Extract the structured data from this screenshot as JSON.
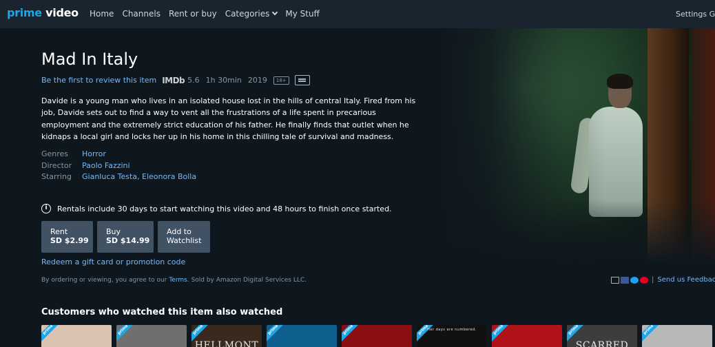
{
  "nav": {
    "logo_part1": "prime",
    "logo_part2": "video",
    "items": [
      "Home",
      "Channels",
      "Rent or buy",
      "Categories",
      "My Stuff"
    ],
    "settings": "Settings",
    "settings_partial": "G"
  },
  "title": "Mad In Italy",
  "meta": {
    "review_link": "Be the first to review this item",
    "imdb_label": "IMDb",
    "imdb_rating": "5.6",
    "runtime": "1h 30min",
    "year": "2019",
    "rating_badge": "18+",
    "cc_icon": "subtitles-icon"
  },
  "synopsis": "Davide is a young man who lives in an isolated house lost in the hills of central Italy. Fired from his job, Davide sets out to find a way to vent all the frustrations of a life spent in precarious employment and the extremely strict education of his father. He finally finds that outlet when he kidnaps a local girl and locks her up in his home in this chilling tale of survival and madness.",
  "details": {
    "genres_label": "Genres",
    "genres": "Horror",
    "director_label": "Director",
    "director": "Paolo Fazzini",
    "starring_label": "Starring",
    "starring": "Gianluca Testa, Eleonora Bolla"
  },
  "rental_info": "Rentals include 30 days to start watching this video and 48 hours to finish once started.",
  "buttons": {
    "rent_line1": "Rent",
    "rent_line2": "SD $2.99",
    "buy_line1": "Buy",
    "buy_line2": "SD $14.99",
    "watch_line1": "Add to",
    "watch_line2": "Watchlist"
  },
  "redeem": "Redeem a gift card or promotion code",
  "legal": {
    "before": "By ordering or viewing, you agree to our ",
    "terms": "Terms",
    "after": ". Sold by Amazon Digital Services LLC."
  },
  "social": {
    "separator": "|",
    "feedback": "Send us Feedback"
  },
  "row": {
    "title": "Customers who watched this item also watched",
    "ribbon": "prime",
    "thumbs": [
      {
        "bg": "#d9c3b0",
        "text": ""
      },
      {
        "bg": "#6f6f6f",
        "text": ""
      },
      {
        "bg": "#3a2a1e",
        "text": "HELLMONT"
      },
      {
        "bg": "#0f5f8f",
        "text": ""
      },
      {
        "bg": "#8a0f12",
        "text": ""
      },
      {
        "bg": "#111111",
        "text": "Her days are numbered."
      },
      {
        "bg": "#b0121a",
        "text": ""
      },
      {
        "bg": "#3d3d3d",
        "text": "SCARRED"
      },
      {
        "bg": "#b8b8b8",
        "text": ""
      }
    ]
  },
  "colors": {
    "background": "#0f171e",
    "topbar": "#1a242f",
    "link": "#79b8f3",
    "muted": "#8197a4",
    "button": "#425265",
    "prime_blue": "#1ea6e6"
  }
}
